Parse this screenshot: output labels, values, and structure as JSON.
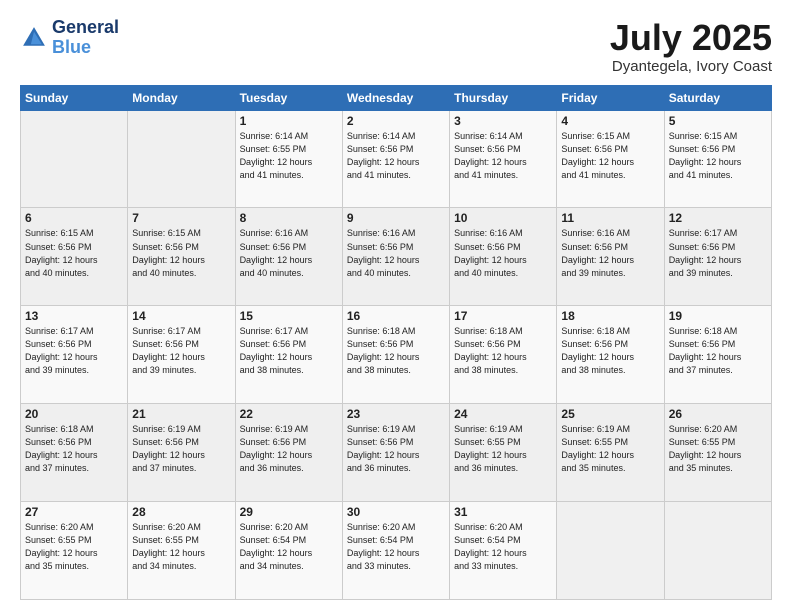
{
  "header": {
    "logo_line1": "General",
    "logo_line2": "Blue",
    "title": "July 2025",
    "subtitle": "Dyantegela, Ivory Coast"
  },
  "days_of_week": [
    "Sunday",
    "Monday",
    "Tuesday",
    "Wednesday",
    "Thursday",
    "Friday",
    "Saturday"
  ],
  "weeks": [
    [
      {
        "day": "",
        "info": ""
      },
      {
        "day": "",
        "info": ""
      },
      {
        "day": "1",
        "info": "Sunrise: 6:14 AM\nSunset: 6:55 PM\nDaylight: 12 hours\nand 41 minutes."
      },
      {
        "day": "2",
        "info": "Sunrise: 6:14 AM\nSunset: 6:56 PM\nDaylight: 12 hours\nand 41 minutes."
      },
      {
        "day": "3",
        "info": "Sunrise: 6:14 AM\nSunset: 6:56 PM\nDaylight: 12 hours\nand 41 minutes."
      },
      {
        "day": "4",
        "info": "Sunrise: 6:15 AM\nSunset: 6:56 PM\nDaylight: 12 hours\nand 41 minutes."
      },
      {
        "day": "5",
        "info": "Sunrise: 6:15 AM\nSunset: 6:56 PM\nDaylight: 12 hours\nand 41 minutes."
      }
    ],
    [
      {
        "day": "6",
        "info": "Sunrise: 6:15 AM\nSunset: 6:56 PM\nDaylight: 12 hours\nand 40 minutes."
      },
      {
        "day": "7",
        "info": "Sunrise: 6:15 AM\nSunset: 6:56 PM\nDaylight: 12 hours\nand 40 minutes."
      },
      {
        "day": "8",
        "info": "Sunrise: 6:16 AM\nSunset: 6:56 PM\nDaylight: 12 hours\nand 40 minutes."
      },
      {
        "day": "9",
        "info": "Sunrise: 6:16 AM\nSunset: 6:56 PM\nDaylight: 12 hours\nand 40 minutes."
      },
      {
        "day": "10",
        "info": "Sunrise: 6:16 AM\nSunset: 6:56 PM\nDaylight: 12 hours\nand 40 minutes."
      },
      {
        "day": "11",
        "info": "Sunrise: 6:16 AM\nSunset: 6:56 PM\nDaylight: 12 hours\nand 39 minutes."
      },
      {
        "day": "12",
        "info": "Sunrise: 6:17 AM\nSunset: 6:56 PM\nDaylight: 12 hours\nand 39 minutes."
      }
    ],
    [
      {
        "day": "13",
        "info": "Sunrise: 6:17 AM\nSunset: 6:56 PM\nDaylight: 12 hours\nand 39 minutes."
      },
      {
        "day": "14",
        "info": "Sunrise: 6:17 AM\nSunset: 6:56 PM\nDaylight: 12 hours\nand 39 minutes."
      },
      {
        "day": "15",
        "info": "Sunrise: 6:17 AM\nSunset: 6:56 PM\nDaylight: 12 hours\nand 38 minutes."
      },
      {
        "day": "16",
        "info": "Sunrise: 6:18 AM\nSunset: 6:56 PM\nDaylight: 12 hours\nand 38 minutes."
      },
      {
        "day": "17",
        "info": "Sunrise: 6:18 AM\nSunset: 6:56 PM\nDaylight: 12 hours\nand 38 minutes."
      },
      {
        "day": "18",
        "info": "Sunrise: 6:18 AM\nSunset: 6:56 PM\nDaylight: 12 hours\nand 38 minutes."
      },
      {
        "day": "19",
        "info": "Sunrise: 6:18 AM\nSunset: 6:56 PM\nDaylight: 12 hours\nand 37 minutes."
      }
    ],
    [
      {
        "day": "20",
        "info": "Sunrise: 6:18 AM\nSunset: 6:56 PM\nDaylight: 12 hours\nand 37 minutes."
      },
      {
        "day": "21",
        "info": "Sunrise: 6:19 AM\nSunset: 6:56 PM\nDaylight: 12 hours\nand 37 minutes."
      },
      {
        "day": "22",
        "info": "Sunrise: 6:19 AM\nSunset: 6:56 PM\nDaylight: 12 hours\nand 36 minutes."
      },
      {
        "day": "23",
        "info": "Sunrise: 6:19 AM\nSunset: 6:56 PM\nDaylight: 12 hours\nand 36 minutes."
      },
      {
        "day": "24",
        "info": "Sunrise: 6:19 AM\nSunset: 6:55 PM\nDaylight: 12 hours\nand 36 minutes."
      },
      {
        "day": "25",
        "info": "Sunrise: 6:19 AM\nSunset: 6:55 PM\nDaylight: 12 hours\nand 35 minutes."
      },
      {
        "day": "26",
        "info": "Sunrise: 6:20 AM\nSunset: 6:55 PM\nDaylight: 12 hours\nand 35 minutes."
      }
    ],
    [
      {
        "day": "27",
        "info": "Sunrise: 6:20 AM\nSunset: 6:55 PM\nDaylight: 12 hours\nand 35 minutes."
      },
      {
        "day": "28",
        "info": "Sunrise: 6:20 AM\nSunset: 6:55 PM\nDaylight: 12 hours\nand 34 minutes."
      },
      {
        "day": "29",
        "info": "Sunrise: 6:20 AM\nSunset: 6:54 PM\nDaylight: 12 hours\nand 34 minutes."
      },
      {
        "day": "30",
        "info": "Sunrise: 6:20 AM\nSunset: 6:54 PM\nDaylight: 12 hours\nand 33 minutes."
      },
      {
        "day": "31",
        "info": "Sunrise: 6:20 AM\nSunset: 6:54 PM\nDaylight: 12 hours\nand 33 minutes."
      },
      {
        "day": "",
        "info": ""
      },
      {
        "day": "",
        "info": ""
      }
    ]
  ]
}
